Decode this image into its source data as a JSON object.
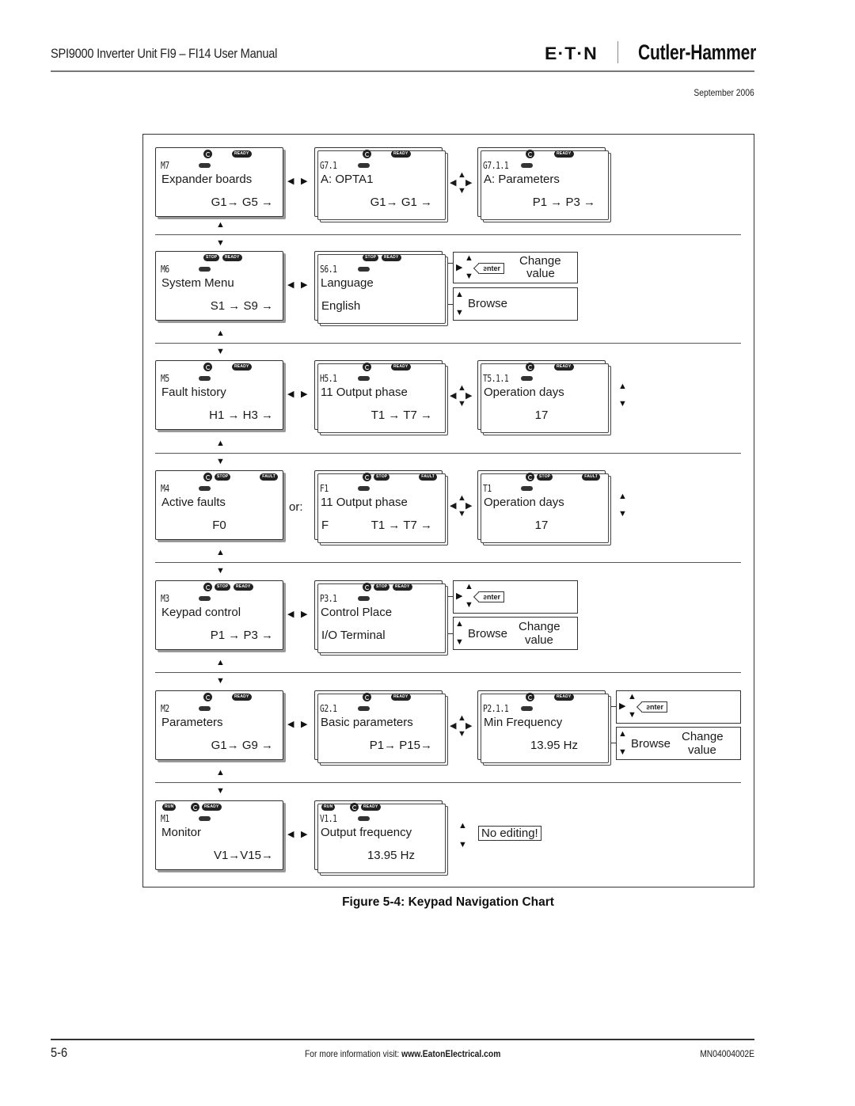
{
  "header": {
    "title": "SPI9000 Inverter Unit FI9 – FI14 User Manual",
    "logo_eaton": "E·T·N",
    "logo_brand": "Cutler-Hammer",
    "date": "September 2006"
  },
  "figure": {
    "caption": "Figure 5-4: Keypad Navigation Chart",
    "or_label": "or:",
    "no_editing": "No editing!",
    "enter_key": "enter",
    "hints": {
      "change": "Change",
      "value": "value",
      "browse": "Browse"
    },
    "rows": [
      {
        "menu": {
          "code": "M7",
          "status": [
            "dir",
            "READY"
          ],
          "line1": "Expander boards",
          "line2": "G1→ G5 →"
        },
        "sub": {
          "code": "G7.1",
          "status": [
            "dir",
            "READY"
          ],
          "line1": "A: OPTA1",
          "line2": "G1→ G1 →"
        },
        "param": {
          "code": "G7.1.1",
          "status": [
            "dir",
            "READY"
          ],
          "line1": "A: Parameters",
          "line2": "P1 → P3 →"
        }
      },
      {
        "menu": {
          "code": "M6",
          "status": [
            "STOP",
            "READY"
          ],
          "line1": "System Menu",
          "line2": "S1 → S9 →"
        },
        "sub": {
          "code": "S6.1",
          "status": [
            "STOP",
            "READY"
          ],
          "line1": "Language",
          "line2": "English"
        }
      },
      {
        "menu": {
          "code": "M5",
          "status": [
            "dir",
            "READY"
          ],
          "line1": "Fault history",
          "line2": "H1 → H3 →"
        },
        "sub": {
          "code": "H5.1",
          "status": [
            "dir",
            "READY"
          ],
          "line1": "11 Output phase",
          "line2": "T1 → T7 →"
        },
        "param": {
          "code": "T5.1.1",
          "status": [
            "dir",
            "READY"
          ],
          "line1": "Operation days",
          "line2": "17"
        }
      },
      {
        "menu": {
          "code": "M4",
          "status": [
            "dir",
            "STOP",
            "FAULT"
          ],
          "line1": "Active faults",
          "line2": "F0"
        },
        "sub": {
          "code": "F1",
          "status": [
            "dir",
            "STOP",
            "FAULT"
          ],
          "line1": "11 Output phase",
          "line2a": "F",
          "line2": "T1 → T7 →"
        },
        "param": {
          "code": "T1",
          "status": [
            "dir",
            "STOP",
            "FAULT"
          ],
          "line1": "Operation days",
          "line2": "17"
        }
      },
      {
        "menu": {
          "code": "M3",
          "status": [
            "dir",
            "STOP",
            "READY"
          ],
          "line1": "Keypad control",
          "line2": "P1 → P3 →"
        },
        "sub": {
          "code": "P3.1",
          "status": [
            "dir",
            "STOP",
            "READY"
          ],
          "line1": "Control Place",
          "line2": "I/O Terminal"
        }
      },
      {
        "menu": {
          "code": "M2",
          "status": [
            "dir",
            "READY"
          ],
          "line1": "Parameters",
          "line2": "G1→ G9 →"
        },
        "sub": {
          "code": "G2.1",
          "status": [
            "dir",
            "READY"
          ],
          "line1": "Basic parameters",
          "line2": "P1→ P15→"
        },
        "param": {
          "code": "P2.1.1",
          "status": [
            "dir",
            "READY"
          ],
          "line1": "Min Frequency",
          "line2": "13.95 Hz"
        }
      },
      {
        "menu": {
          "code": "M1",
          "status": [
            "RUN",
            "dir",
            "READY"
          ],
          "line1": "Monitor",
          "line2": "V1→V15→"
        },
        "sub": {
          "code": "V1.1",
          "status": [
            "RUN",
            "dir",
            "READY"
          ],
          "line1": "Output frequency",
          "line2": "13.95 Hz"
        }
      }
    ]
  },
  "footer": {
    "page": "5-6",
    "info_prefix": "For more information visit: ",
    "info_url": "www.EatonElectrical.com",
    "doc_number": "MN04004002E"
  }
}
